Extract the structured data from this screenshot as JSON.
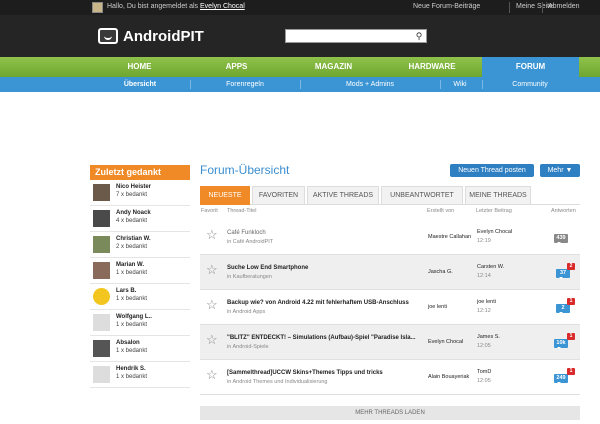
{
  "topbar": {
    "greeting": "Hallo, Du bist angemeldet als",
    "username": "Evelyn Chocal",
    "links": [
      "Neue Forum-Beiträge",
      "Meine Seite",
      "Abmelden"
    ]
  },
  "header": {
    "logo_text": "AndroidPIT",
    "search_value": "",
    "search_icon": "magnifier-icon"
  },
  "main_nav": [
    "HOME",
    "APPS",
    "MAGAZIN",
    "HARDWARE",
    "FORUM"
  ],
  "sub_nav": [
    "Übersicht",
    "Forenregeln",
    "Mods + Admins",
    "Wiki",
    "Community"
  ],
  "sidebar": {
    "title": "Zuletzt gedankt",
    "users": [
      {
        "name": "Nico Heister",
        "count": "7 x bedankt"
      },
      {
        "name": "Andy Noack",
        "count": "4 x bedankt"
      },
      {
        "name": "Christian W.",
        "count": "2 x bedankt"
      },
      {
        "name": "Marian W.",
        "count": "1 x bedankt"
      },
      {
        "name": "Lars B.",
        "count": "1 x bedankt"
      },
      {
        "name": "Wolfgang L..",
        "count": "1 x bedankt"
      },
      {
        "name": "Absalon",
        "count": "1 x bedankt"
      },
      {
        "name": "Hendrik S.",
        "count": "1 x bedankt"
      }
    ]
  },
  "content": {
    "title": "Forum-Übersicht",
    "new_thread_label": "Neuen Thread posten",
    "more_label": "Mehr ▼",
    "tabs": [
      "NEUESTE",
      "FAVORITEN",
      "AKTIVE THREADS",
      "UNBEANTWORTET",
      "MEINE THREADS"
    ],
    "columns": [
      "Favorit",
      "Thread-Titel",
      "Erstellt von",
      "Letzter Beitrag",
      "Antworten"
    ],
    "threads": [
      {
        "title": "Café Funkloch",
        "category": "in Café AndroidPIT",
        "author": "Maestre Callahan",
        "last_user": "Evelyn Chocal",
        "last_time": "12:19",
        "replies": "439",
        "new": ""
      },
      {
        "title": "Suche Low End Smartphone",
        "category": "in Kaufberatungen",
        "author": "Jascha G.",
        "last_user": "Carsten W.",
        "last_time": "12:14",
        "replies": "37",
        "new": "2"
      },
      {
        "title": "Backup wie? von Android 4.22 mit fehlerhaftem USB-Anschluss",
        "category": "in Android Apps",
        "author": "joe lenti",
        "last_user": "joe lenti",
        "last_time": "12:12",
        "replies": "2",
        "new": "1"
      },
      {
        "title": "\"BLITZ\" ENTDECKT! – Simulations (Aufbau)-Spiel \"Paradise Isla...",
        "category": "in Android-Spiele",
        "author": "Evelyn Chocal",
        "last_user": "James S.",
        "last_time": "12:05",
        "replies": "10k",
        "new": "1"
      },
      {
        "title": "[Sammelthread]UCCW Skins+Themes Tipps und tricks",
        "category": "in Android Themes und Individualisierung",
        "author": "Alain Bouayeriak",
        "last_user": "TomD",
        "last_time": "12:05",
        "replies": "249",
        "new": "1"
      }
    ],
    "load_more_label": "MEHR THREADS LADEN"
  }
}
